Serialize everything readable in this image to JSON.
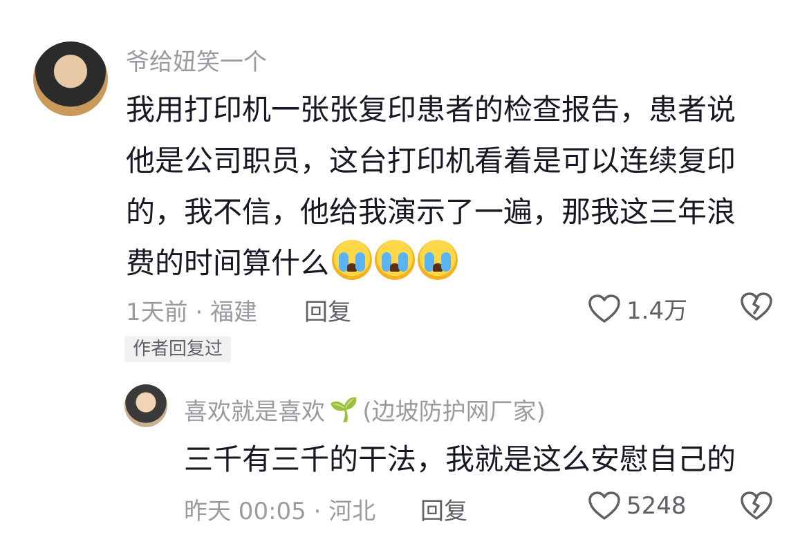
{
  "comment": {
    "username": "爷给妞笑一个",
    "text_lines": [
      "我用打印机一张张复印患者的检查报告，患者说",
      "他是公司职员，这台打印机看着是可以连续复印",
      "的，我不信，他给我演示了一遍，那我这三年浪",
      "费的时间算什么"
    ],
    "emojis": [
      "crying-face-emoji",
      "crying-face-emoji",
      "crying-face-emoji"
    ],
    "meta": "1天前 · 福建",
    "reply_label": "回复",
    "likes": "1.4万",
    "author_badge": "作者回复过"
  },
  "reply": {
    "username": "喜欢就是喜欢",
    "username_suffix": "(边坡防护网厂家)",
    "text": "三千有三千的干法，我就是这么安慰自己的",
    "meta": "昨天 00:05 · 河北",
    "reply_label": "回复",
    "likes": "5248"
  },
  "icons": {
    "heart": "heart-outline-icon",
    "dislike": "broken-heart-icon",
    "sprout": "seedling-icon"
  },
  "colors": {
    "text": "#161823",
    "meta": "#9a9aa0",
    "action": "#5f6066",
    "badge_bg": "#f1f1f2"
  }
}
